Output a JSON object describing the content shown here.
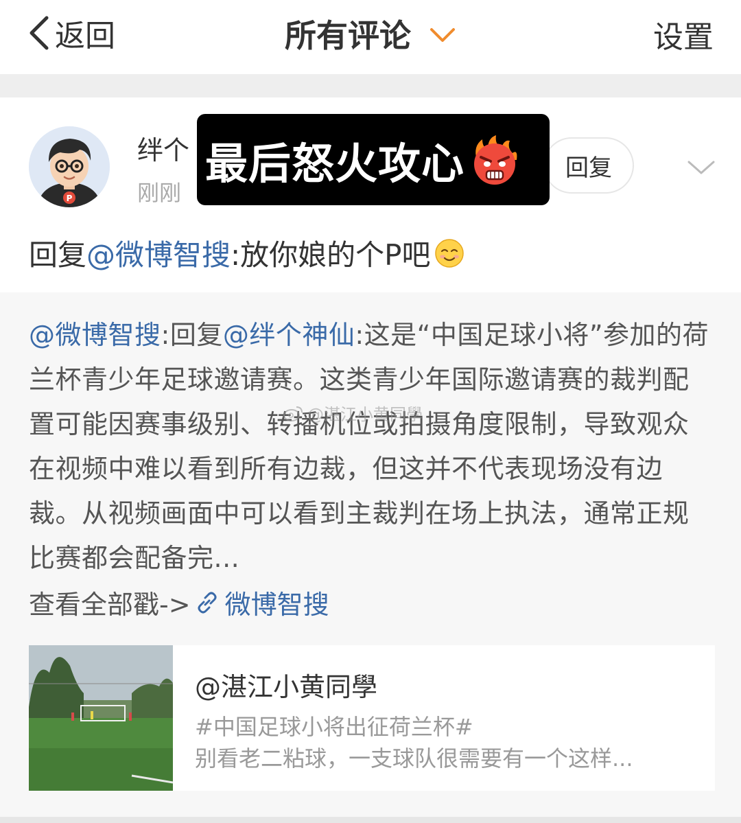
{
  "header": {
    "back_label": "返回",
    "title": "所有评论",
    "settings_label": "设置"
  },
  "comment": {
    "username_visible": "绊个",
    "time": "刚刚",
    "reply_button": "回复",
    "overlay_caption": "最后怒火攻心",
    "text_prefix": "回复",
    "text_mention": "@微博智搜",
    "text_body": ":放你娘的个P吧"
  },
  "quoted": {
    "mention1": "@微博智搜",
    "reply_word": ":回复",
    "mention2": "@绊个神仙",
    "body": ":这是“中国足球小将”参加的荷兰杯青少年足球邀请赛。这类青少年国际邀请赛的裁判配置可能因赛事级别、转播机位或拍摄角度限制，导致观众在视频中难以看到所有边裁，但这并不代表现场没有边裁。从视频画面中可以看到主裁判在场上执法，通常正规比赛都会配备完...",
    "view_all": "查看全部戳->",
    "view_link": "微博智搜"
  },
  "card": {
    "title": "@湛江小黄同學",
    "tag": "#中国足球小将出征荷兰杯#",
    "desc": "别看老二粘球，一支球队很需要有一个这样..."
  },
  "watermark": "@湛江小黄同學",
  "colors": {
    "link": "#3a6aa8",
    "accent_chevron": "#f08c2e",
    "overlay_bg": "#000000"
  },
  "icons": [
    "back-chevron-icon",
    "dropdown-chevron-icon",
    "expand-chevron-icon",
    "angry-emoji-icon",
    "smile-emoji-icon",
    "link-icon",
    "weibo-logo-icon"
  ]
}
